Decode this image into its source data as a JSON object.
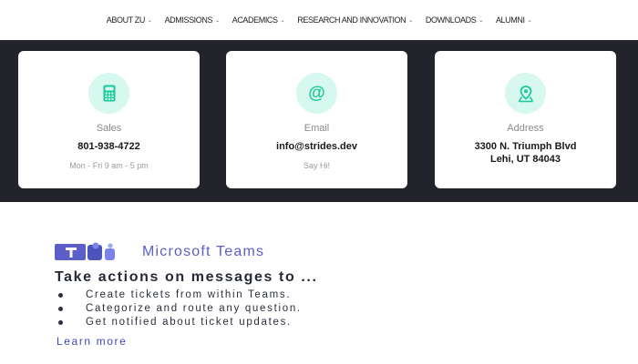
{
  "nav": {
    "items": [
      {
        "label": "ABOUT ZU"
      },
      {
        "label": "ADMISSIONS"
      },
      {
        "label": "ACADEMICS"
      },
      {
        "label": "RESEARCH AND INNOVATION"
      },
      {
        "label": "DOWNLOADS"
      },
      {
        "label": "ALUMNI"
      }
    ],
    "chevron_icon": "chevron-down-icon"
  },
  "contact": {
    "sales": {
      "icon": "calculator-icon",
      "label": "Sales",
      "value": "801-938-4722",
      "sub": "Mon - Fri 9 am - 5 pm"
    },
    "email": {
      "icon": "at-sign-icon",
      "label": "Email",
      "value": "info@strides.dev",
      "sub": "Say Hi!"
    },
    "address": {
      "icon": "map-pin-icon",
      "label": "Address",
      "line1": "3300 N. Triumph Blvd",
      "line2": "Lehi, UT 84043"
    }
  },
  "teams": {
    "logo_icon": "microsoft-teams-logo",
    "brand": "Microsoft Teams",
    "title": "Take actions on messages to ...",
    "bullets": [
      "Create tickets from within Teams.",
      "Categorize and route any question.",
      "Get notified about ticket updates."
    ],
    "link": "Learn more"
  },
  "colors": {
    "band": "#22232b",
    "accent": "#1cc99a",
    "icon_bg": "#d7f8ee",
    "teams_purple": "#5b5fc7",
    "link": "#3f48b8"
  }
}
